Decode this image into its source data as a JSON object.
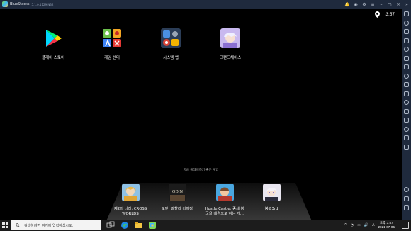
{
  "window": {
    "app_name": "BlueStacks",
    "version": "5.1.0.1129 N32",
    "title_icons": [
      "bell-icon",
      "account-icon",
      "settings-icon",
      "menu-icon",
      "minimize-icon",
      "restore-icon",
      "close-icon",
      "expand-icon"
    ],
    "title_glyphs": [
      "🔔",
      "◉",
      "⚙",
      "≡",
      "–",
      "▢",
      "✕",
      "»"
    ]
  },
  "status_bar": {
    "time": "3:57",
    "icon": "location-icon"
  },
  "home_apps": [
    {
      "label": "플레이 스토어",
      "icon": "play-store-icon"
    },
    {
      "label": "게임 센터",
      "icon": "game-center-icon"
    },
    {
      "label": "시스템 앱",
      "icon": "system-apps-icon"
    },
    {
      "label": "그랜드체이스",
      "icon": "grandchase-icon"
    }
  ],
  "recent": {
    "title": "지금 플레이하기 좋은 게임",
    "apps": [
      {
        "label_line1": "제2의 나라: CROSS",
        "label_line2": "WORLDS",
        "icon": "ni-no-kuni-icon"
      },
      {
        "label_line1": "오딘: 발할라 라이징",
        "label_line2": "",
        "icon": "odin-icon",
        "icon_text": "ODIN"
      },
      {
        "label_line1": "Hustle Castle: 중세 왕",
        "label_line2": "국을 배경으로 하는 게...",
        "icon": "hustle-castle-icon"
      },
      {
        "label_line1": "붕괴3rd",
        "label_line2": "",
        "icon": "honkai-icon"
      }
    ]
  },
  "sidebar": {
    "icons": [
      "fullscreen-icon",
      "volume-icon",
      "keyboard-icon",
      "rotate-icon",
      "shake-icon",
      "camera-icon",
      "record-icon",
      "location-pin-icon",
      "macro-icon",
      "folder-icon",
      "apk-icon",
      "multi-instance-icon",
      "eco-mode-icon",
      "screenshot-icon",
      "help-icon",
      "settings-icon",
      "back-icon",
      "home-icon",
      "recents-icon"
    ]
  },
  "taskbar": {
    "search_placeholder": "검색하려면 여기에 입력하십시오.",
    "pinned": [
      "task-view-icon",
      "edge-icon",
      "file-explorer-icon",
      "bluestacks-taskbar-icon"
    ],
    "tray_icons": [
      "^",
      "◔",
      "▭",
      "🔊",
      "A"
    ],
    "time": "오후 3:57",
    "date": "2021-07-05"
  }
}
